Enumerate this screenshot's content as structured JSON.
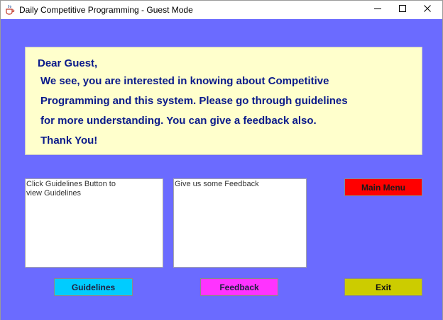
{
  "window": {
    "title": "Daily Competitive Programming - Guest Mode",
    "background_color": "#6b6bff"
  },
  "message": {
    "greeting": "Dear Guest,",
    "line1": "We see, you are interested in knowing about Competitive",
    "line2": "Programming and this system. Please go through guidelines",
    "line3": "for more understanding. You can give a feedback also.",
    "closing": "Thank You!",
    "background_color": "#ffffcc",
    "text_color": "#0a1a8a"
  },
  "guidelines_area": {
    "text": "Click Guidelines Button to\nview Guidelines"
  },
  "feedback_area": {
    "text": "Give us some Feedback"
  },
  "buttons": {
    "main_menu": {
      "label": "Main Menu",
      "color": "#ff0000"
    },
    "guidelines": {
      "label": "Guidelines",
      "color": "#00ccff"
    },
    "feedback": {
      "label": "Feedback",
      "color": "#ff33ff"
    },
    "exit": {
      "label": "Exit",
      "color": "#cccc00"
    }
  },
  "icons": {
    "app": "java-coffee-cup-icon",
    "minimize": "minimize-icon",
    "maximize": "maximize-icon",
    "close": "close-icon"
  }
}
